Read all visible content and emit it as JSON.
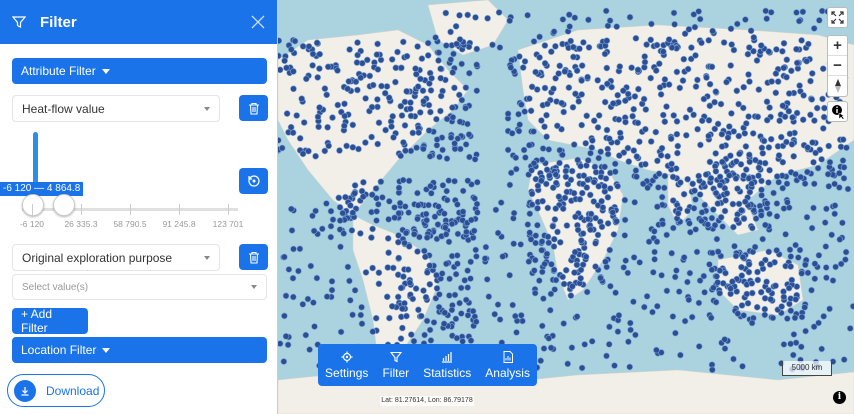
{
  "sidebar": {
    "title": "Filter",
    "attribute_filter_label": "Attribute Filter",
    "heat_flow_select": "Heat-flow value",
    "range_label": "-6 120 — 4 864.8",
    "range_min_fraction": 0.0,
    "range_max_fraction": 0.085,
    "ticks": [
      "-6 120",
      "26 335.3",
      "58 790.5",
      "91 245.8",
      "123 701"
    ],
    "purpose_select": "Original exploration purpose",
    "values_placeholder": "Select value(s)",
    "add_filter_label": "+ Add Filter",
    "location_filter_label": "Location Filter",
    "download_label": "Download"
  },
  "toolbar": {
    "items": [
      {
        "label": "Settings",
        "icon": "gear-icon"
      },
      {
        "label": "Filter",
        "icon": "funnel-icon"
      },
      {
        "label": "Statistics",
        "icon": "bar-chart-icon"
      },
      {
        "label": "Analysis",
        "icon": "document-chart-icon"
      }
    ]
  },
  "map": {
    "scale_label": "5000 km",
    "coords_label": "Lat: 81.27614, Lon: 86.79178",
    "zoom_in": "+",
    "zoom_out": "−",
    "info_symbol": "i",
    "colors": {
      "water": "#aad3df",
      "land": "#f2efe9",
      "point": "#2c4e94",
      "accent": "#1a73e8"
    }
  }
}
